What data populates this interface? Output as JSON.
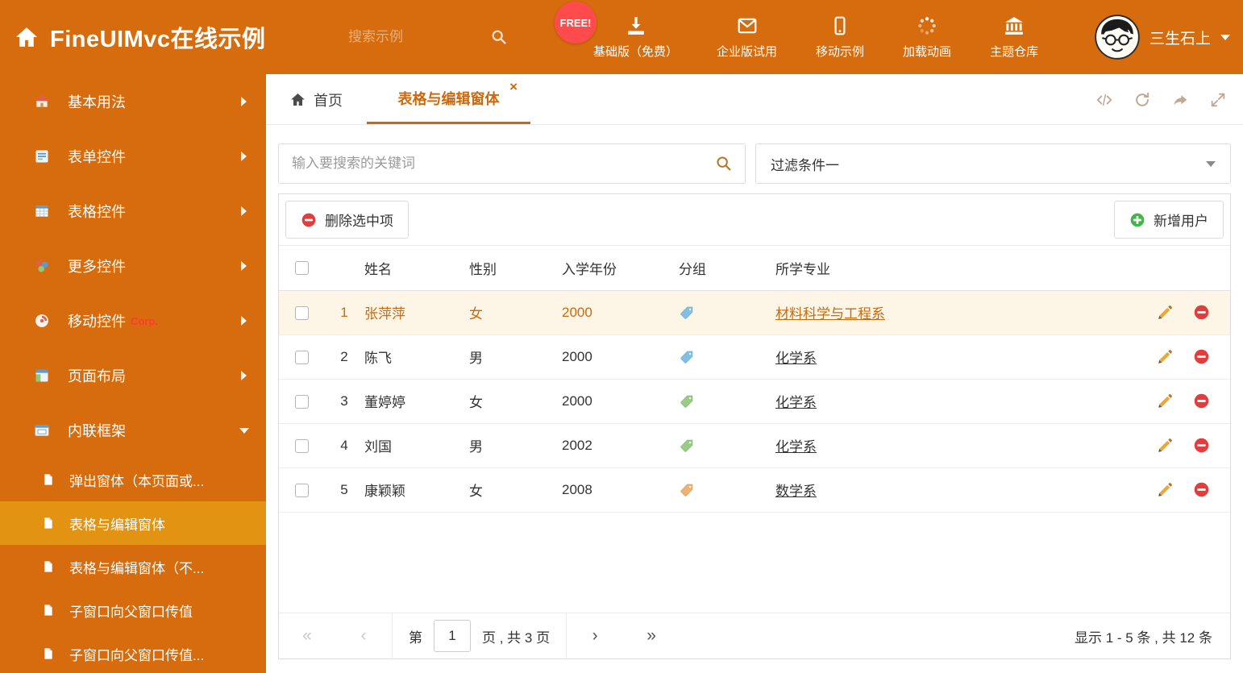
{
  "header": {
    "title": "FineUIMvc在线示例",
    "search_placeholder": "搜索示例",
    "free_badge": "FREE!",
    "nav_items": [
      {
        "label": "基础版（免费）",
        "icon": "download-icon"
      },
      {
        "label": "企业版试用",
        "icon": "envelope-icon"
      },
      {
        "label": "移动示例",
        "icon": "mobile-icon"
      },
      {
        "label": "加载动画",
        "icon": "spinner-icon"
      },
      {
        "label": "主题仓库",
        "icon": "theme-repo-icon"
      }
    ],
    "user_name": "三生石上"
  },
  "sidebar": {
    "items": [
      {
        "label": "基本用法",
        "icon": "home-icon"
      },
      {
        "label": "表单控件",
        "icon": "form-icon"
      },
      {
        "label": "表格控件",
        "icon": "table-icon"
      },
      {
        "label": "更多控件",
        "icon": "more-icon"
      },
      {
        "label": "移动控件",
        "icon": "mobile-side-icon",
        "badge": "Corp."
      },
      {
        "label": "页面布局",
        "icon": "layout-icon"
      },
      {
        "label": "内联框架",
        "icon": "frame-icon",
        "expanded": true
      }
    ],
    "subitems": [
      {
        "label": "弹出窗体（本页面或..."
      },
      {
        "label": "表格与编辑窗体",
        "active": true
      },
      {
        "label": "表格与编辑窗体（不..."
      },
      {
        "label": "子窗口向父窗口传值"
      },
      {
        "label": "子窗口向父窗口传值..."
      }
    ]
  },
  "tabs": {
    "home_label": "首页",
    "active_label": "表格与编辑窗体"
  },
  "filter": {
    "search_placeholder": "输入要搜索的关键词",
    "dropdown_value": "过滤条件一"
  },
  "actions": {
    "delete_label": "删除选中项",
    "add_label": "新增用户"
  },
  "table": {
    "columns": [
      "姓名",
      "性别",
      "入学年份",
      "分组",
      "所学专业"
    ],
    "rows": [
      {
        "index": "1",
        "name": "张萍萍",
        "gender": "女",
        "year": "2000",
        "tag_color": "#7fc0e8",
        "major": "材料科学与工程系",
        "selected": true
      },
      {
        "index": "2",
        "name": "陈飞",
        "gender": "男",
        "year": "2000",
        "tag_color": "#7fc0e8",
        "major": "化学系",
        "selected": false
      },
      {
        "index": "3",
        "name": "董婷婷",
        "gender": "女",
        "year": "2000",
        "tag_color": "#98cb83",
        "major": "化学系",
        "selected": false
      },
      {
        "index": "4",
        "name": "刘国",
        "gender": "男",
        "year": "2002",
        "tag_color": "#98cb83",
        "major": "化学系",
        "selected": false
      },
      {
        "index": "5",
        "name": "康颖颖",
        "gender": "女",
        "year": "2008",
        "tag_color": "#f2b26d",
        "major": "数学系",
        "selected": false
      }
    ]
  },
  "pagination": {
    "prefix": "第",
    "current_page": "1",
    "suffix": "页 , 共 3 页",
    "summary": "显示 1 - 5 条 , 共 12 条"
  },
  "colors": {
    "theme_orange": "#d66c0d",
    "sidebar_active_bg": "#e39312",
    "link_orange": "#c96a0e",
    "selected_row_bg": "#fdf6e7",
    "delete_red": "#e23c3c",
    "add_green": "#43b649",
    "free_badge_red": "#ff4b4b"
  }
}
